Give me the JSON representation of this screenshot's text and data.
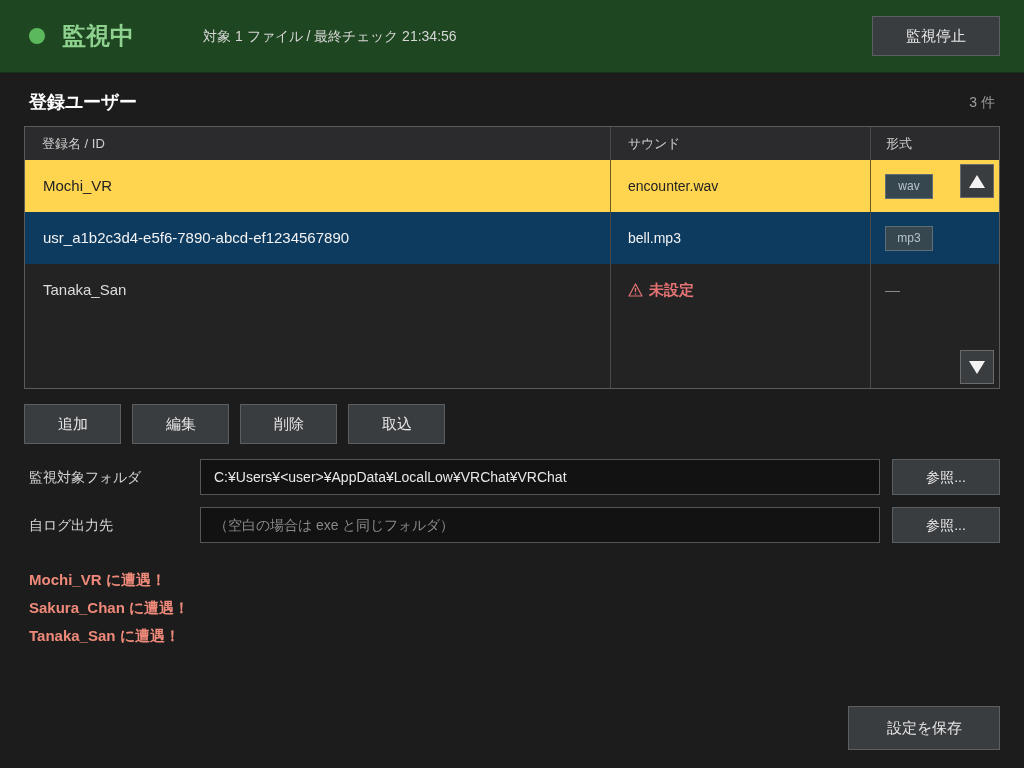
{
  "header": {
    "status": "監視中",
    "active": true,
    "summary": "対象 1 ファイル / 最終チェック 21:34:56",
    "stop_button": "監視停止"
  },
  "users": {
    "title": "登録ユーザー",
    "count": "3 件",
    "columns": [
      "登録名 / ID",
      "サウンド",
      "形式"
    ],
    "rows": [
      {
        "name": "Mochi_VR",
        "sound": "encounter.wav",
        "sound_missing": false,
        "format": {
          "kind": "badge",
          "text": "wav"
        },
        "highlighted": true,
        "selected": false
      },
      {
        "name": "usr_a1b2c3d4-e5f6-7890-abcd-ef1234567890",
        "sound": "bell.mp3",
        "sound_missing": false,
        "format": {
          "kind": "badge",
          "text": "mp3"
        },
        "highlighted": false,
        "selected": true
      },
      {
        "name": "Tanaka_San",
        "sound": "未設定",
        "sound_missing": true,
        "format": {
          "kind": "dash",
          "text": "—"
        },
        "highlighted": false,
        "selected": false
      }
    ]
  },
  "actions": [
    "追加",
    "編集",
    "削除",
    "取込"
  ],
  "settings": [
    {
      "label": "監視対象フォルダ",
      "value": "C:¥Users¥<user>¥AppData¥LocalLow¥VRChat¥VRChat",
      "button": "参照..."
    },
    {
      "label": "自ログ出力先",
      "placeholder": "（空白の場合は exe と同じフォルダ）",
      "button": "参照..."
    }
  ],
  "messages": [
    "Mochi_VR に遭遇！",
    "Sakura_Chan に遭遇！",
    "Tanaka_San に遭遇！"
  ],
  "save_button": "設定を保存"
}
